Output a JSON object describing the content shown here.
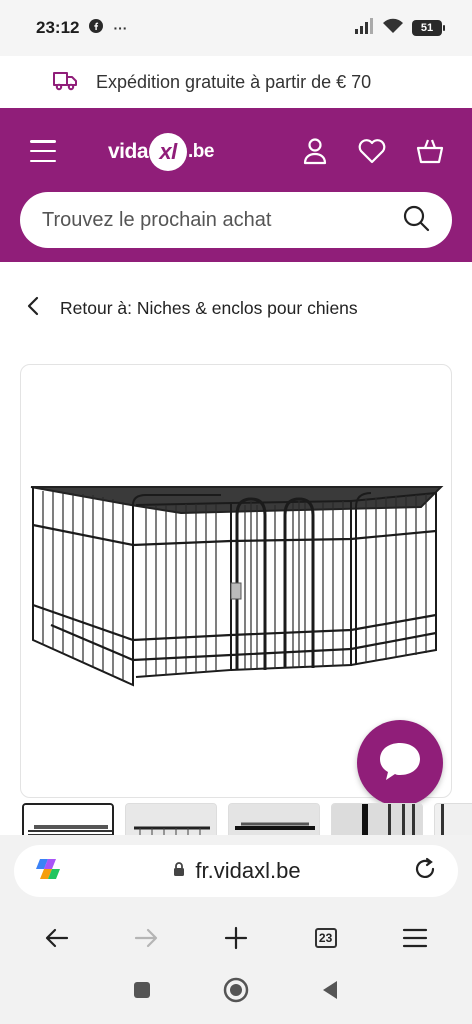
{
  "status_bar": {
    "time": "23:12",
    "more": "···",
    "battery": "51",
    "icons": [
      "facebook-icon",
      "signal-icon",
      "wifi-icon",
      "battery-icon"
    ]
  },
  "promo": {
    "text": "Expédition gratuite à partir de € 70",
    "icon": "delivery-truck-icon"
  },
  "header": {
    "brand_prefix": "vida",
    "brand_mark": "xl",
    "brand_suffix": ".be",
    "background_color": "#901e79",
    "icons": [
      "menu-icon",
      "account-icon",
      "wishlist-icon",
      "cart-icon"
    ]
  },
  "search": {
    "placeholder": "Trouvez le prochain achat",
    "icon": "search-icon"
  },
  "breadcrumb": {
    "text": "Retour à: Niches & enclos pour chiens",
    "icon": "chevron-left-icon"
  },
  "product": {
    "image_subject": "black metal dog pen",
    "thumbnail_count_visible": 5,
    "active_thumbnail": 1
  },
  "chat": {
    "icon": "chat-bubble-icon"
  },
  "browser": {
    "url": "fr.vidaxl.be",
    "tab_count": "23",
    "icons": [
      "copilot-icon",
      "lock-icon",
      "reload-icon",
      "back-icon",
      "forward-icon",
      "new-tab-icon",
      "tabs-icon",
      "menu-icon"
    ]
  },
  "system_nav": {
    "icons": [
      "recents-icon",
      "home-icon",
      "back-triangle-icon"
    ]
  }
}
